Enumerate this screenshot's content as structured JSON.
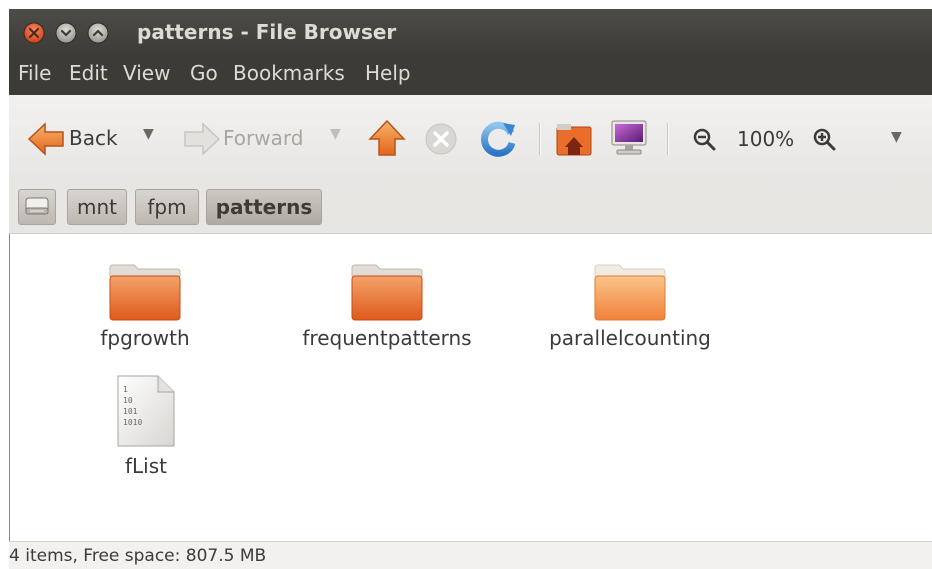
{
  "window": {
    "title": "patterns - File Browser"
  },
  "menubar": {
    "items": [
      "File",
      "Edit",
      "View",
      "Go",
      "Bookmarks",
      "Help"
    ]
  },
  "toolbar": {
    "back_label": "Back",
    "forward_label": "Forward",
    "zoom_level": "100%"
  },
  "breadcrumb": {
    "items": [
      "mnt",
      "fpm",
      "patterns"
    ]
  },
  "files": [
    {
      "name": "fpgrowth",
      "type": "folder"
    },
    {
      "name": "frequentpatterns",
      "type": "folder"
    },
    {
      "name": "parallelcounting",
      "type": "folder"
    },
    {
      "name": "fList",
      "type": "binary-file",
      "icon_text": [
        "1",
        "10",
        "101",
        "1010"
      ]
    }
  ],
  "statusbar": {
    "text": "4 items, Free space: 807.5 MB"
  },
  "colors": {
    "folder": "#e9722f",
    "titlebar": "#3c3b37",
    "close_button": "#e0552d"
  }
}
